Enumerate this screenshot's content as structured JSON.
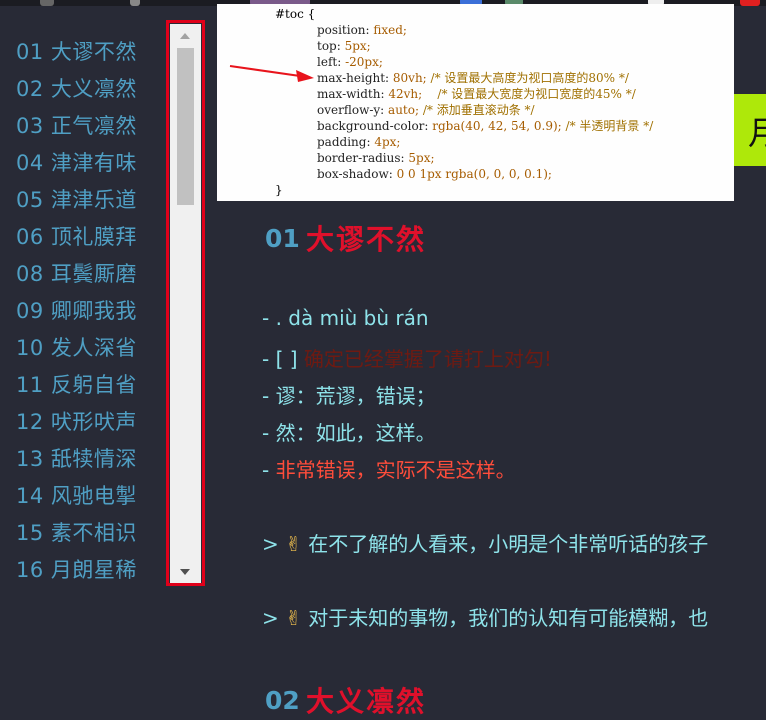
{
  "toc": {
    "items": [
      "01 大谬不然",
      "02 大义凛然",
      "03 正气凛然",
      "04 津津有味",
      "05 津津乐道",
      "06 顶礼膜拜",
      "08 耳鬓厮磨",
      "09 卿卿我我",
      "10 发人深省",
      "11 反躬自省",
      "12 吠形吠声",
      "13 舐犊情深",
      "14 风驰电掣",
      "15 素不相识",
      "16 月朗星稀"
    ]
  },
  "code_popup": {
    "lines": [
      {
        "sel": "#toc {"
      },
      {
        "prop": "position: ",
        "val": "fixed;"
      },
      {
        "prop": "top: ",
        "val": "5px;"
      },
      {
        "prop": "left: ",
        "val": "-20px;"
      },
      {
        "prop": "max-height: ",
        "val": "80vh;",
        "cmt": " /* 设置最大高度为视口高度的80% */"
      },
      {
        "prop": "max-width: ",
        "val": "42vh;",
        "cmt": "    /* 设置最大宽度为视口宽度的45% */"
      },
      {
        "prop": "overflow-y: ",
        "val": "auto;",
        "cmt": " /* 添加垂直滚动条 */"
      },
      {
        "prop": "background-color: ",
        "val": "rgba(40, 42, 54, 0.9);",
        "cmt": " /* 半透明背景 */"
      },
      {
        "prop": "padding: ",
        "val": "4px;"
      },
      {
        "prop": "border-radius: ",
        "val": "5px;"
      },
      {
        "prop": "box-shadow: ",
        "val": "0 0 1px rgba(0, 0, 0, 0.1);"
      },
      {
        "sel": "}"
      }
    ]
  },
  "right_edge_glyph": "月",
  "section1": {
    "number": "01",
    "title": "大谬不然",
    "pinyin": "- . dà miù bù rán",
    "checkbox_prefix": "- [ ] ",
    "checkbox_text": "确定已经掌握了请打上对勾!",
    "def1": "- 谬：荒谬，错误；",
    "def2": "- 然：如此，这样。",
    "meaning_prefix": "- ",
    "meaning": "非常错误，实际不是这样。",
    "example1_prefix": "> ",
    "example1_emoji": "✌",
    "example1": " 在不了解的人看来，小明是个非常听话的孩子",
    "example2_prefix": "> ",
    "example2_emoji": "✌",
    "example2": " 对于未知的事物，我们的认知有可能模糊，也"
  },
  "section2": {
    "number": "02",
    "title": "大义凛然"
  },
  "colors": {
    "background": "#282a36",
    "toc_text": "#4f9fc4",
    "heading_red": "#e0102b",
    "body_text": "#8ee3ea",
    "highlight_outline": "#e0001a"
  }
}
